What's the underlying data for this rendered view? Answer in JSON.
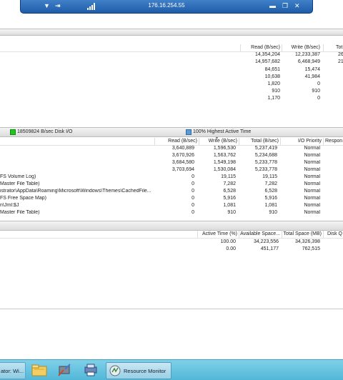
{
  "rdp_bar": {
    "host": "176.16.254.55"
  },
  "network_table": {
    "headers": [
      "Read (B/sec)",
      "Write (B/sec)",
      "Tot"
    ],
    "rows": [
      [
        "14,354,204",
        "12,233,387",
        "26"
      ],
      [
        "14,957,682",
        "6,468,949",
        "21"
      ],
      [
        "84,651",
        "15,474",
        ""
      ],
      [
        "10,638",
        "41,984",
        ""
      ],
      [
        "1,820",
        "0",
        ""
      ],
      [
        "910",
        "910",
        ""
      ],
      [
        "1,170",
        "0",
        ""
      ]
    ]
  },
  "disk_summary": {
    "io_label": "18509824 B/sec Disk I/O",
    "active_label": "100% Highest Active Time",
    "io_color": "#22c322",
    "active_color": "#5b9bd5"
  },
  "disk_table": {
    "headers": [
      "Read (B/sec)",
      "Write (B/sec)",
      "Total (B/sec)",
      "I/O Priority",
      "Respon"
    ],
    "rows": [
      {
        "file": "",
        "read": "3,640,889",
        "write": "1,596,530",
        "total": "5,237,419",
        "priority": "Normal"
      },
      {
        "file": "",
        "read": "3,670,926",
        "write": "1,563,762",
        "total": "5,234,688",
        "priority": "Normal"
      },
      {
        "file": "",
        "read": "3,684,580",
        "write": "1,549,198",
        "total": "5,233,778",
        "priority": "Normal"
      },
      {
        "file": "",
        "read": "3,703,694",
        "write": "1,530,084",
        "total": "5,233,778",
        "priority": "Normal"
      },
      {
        "file": "FS Volume Log)",
        "read": "0",
        "write": "19,115",
        "total": "19,115",
        "priority": "Normal"
      },
      {
        "file": "Master File Table)",
        "read": "0",
        "write": "7,282",
        "total": "7,282",
        "priority": "Normal"
      },
      {
        "file": "istrator\\AppData\\Roaming\\Microsoft\\Windows\\Themes\\CachedFile...",
        "read": "0",
        "write": "6,528",
        "total": "6,528",
        "priority": "Normal"
      },
      {
        "file": "FS Free Space Map)",
        "read": "0",
        "write": "5,916",
        "total": "5,916",
        "priority": "Normal"
      },
      {
        "file": "n\\Jrnl:$J",
        "read": "0",
        "write": "1,081",
        "total": "1,081",
        "priority": "Normal"
      },
      {
        "file": "Master File Table)",
        "read": "0",
        "write": "910",
        "total": "910",
        "priority": "Normal"
      }
    ]
  },
  "storage_table": {
    "headers": [
      "Active Time (%)",
      "Available Space...",
      "Total Space (MB)",
      "Disk Q"
    ],
    "rows": [
      [
        "100.00",
        "34,223,556",
        "34,326,398"
      ],
      [
        "0.00",
        "451,177",
        "762,515"
      ]
    ]
  },
  "taskbar": {
    "left_label": "ator: Wi...",
    "active_app_label": "Resource Monitor"
  }
}
